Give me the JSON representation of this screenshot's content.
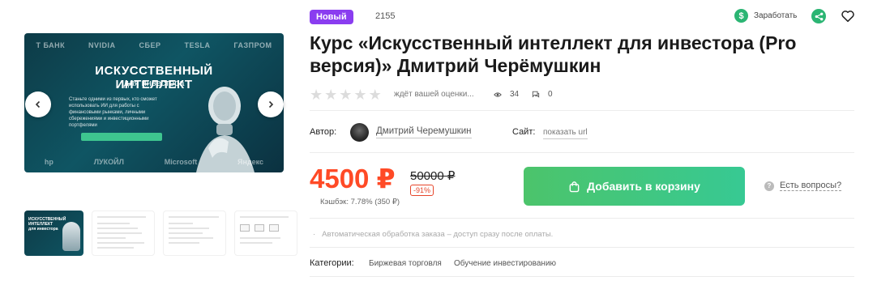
{
  "badge": "Новый",
  "product_id": "2155",
  "earn_label": "Заработать",
  "title": "Курс «Искусственный интеллект для инвестора (Pro версия)» Дмитрий Черёмушкин",
  "rating": {
    "stars_filled": 0,
    "stars_total": 5,
    "text": "ждёт вашей оценки...",
    "views": "34",
    "comments": "0"
  },
  "author": {
    "label": "Автор:",
    "name": "Дмитрий Черемушкин"
  },
  "site": {
    "label": "Сайт:",
    "link": "показать url"
  },
  "price": {
    "current": "4500 ₽",
    "old": "50000 ₽",
    "discount": "-91%",
    "cashback": "Кэшбэк: 7.78% (350 ₽)"
  },
  "cart_button": "Добавить в корзину",
  "questions": "Есть вопросы?",
  "auto_note": "Автоматическая обработка заказа – доступ сразу после оплаты.",
  "categories": {
    "label": "Категории:",
    "items": [
      "Биржевая торговля",
      "Обучение инвестированию"
    ]
  },
  "gallery": {
    "title": "ИСКУССТВЕННЫЙ ИНТЕЛЛЕКТ",
    "subtitle": "для инвестора",
    "body": "Станьте одними из первых, кто сможет использовать ИИ для работы с финансовыми рынками, личными сбережениями и инвестиционными портфелями",
    "logos_top": [
      "T БАНК",
      "NVIDIA",
      "СБЕР",
      "TESLA",
      "ГАЗПРОМ"
    ],
    "logos_bottom": [
      "hp",
      "ЛУКОЙЛ",
      "Microsoft",
      "Яндекс"
    ],
    "thumb_text": "ИСКУССТВЕННЫЙ ИНТЕЛЛЕКТ для инвестора"
  },
  "colors": {
    "badge": "#8a3df0",
    "price": "#ff4a26",
    "cart": "#4cc46b",
    "green_icon": "#2bb573"
  }
}
